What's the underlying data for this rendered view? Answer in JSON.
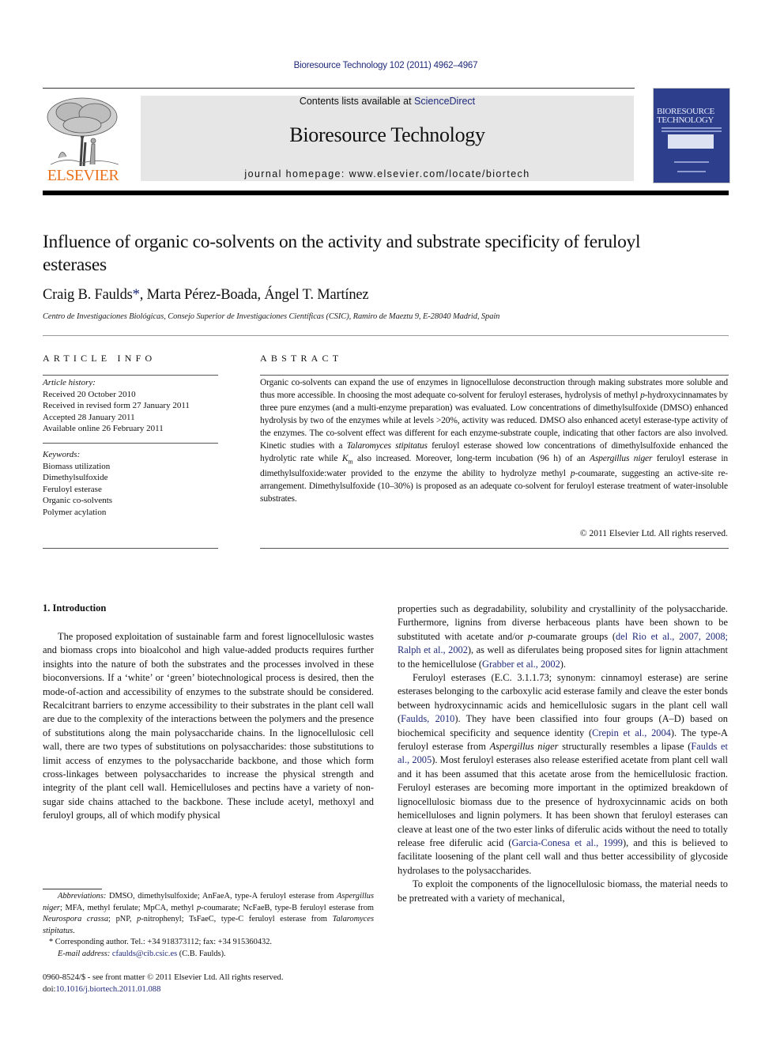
{
  "header": {
    "journal_ref": "Bioresource Technology 102 (2011) 4962–4967",
    "publisher_logo": "elsevier-tree-logo",
    "publisher_name": "ELSEVIER",
    "contents_prefix": "Contents lists available at ",
    "contents_link": "ScienceDirect",
    "journal_name": "Bioresource Technology",
    "homepage": "journal homepage: www.elsevier.com/locate/biortech",
    "cover_title_line1": "BIORESOURCE",
    "cover_title_line2": "TECHNOLOGY",
    "colors": {
      "elsevier_orange": "#e9711c",
      "link_blue": "#1f2a7a",
      "masthead_gray": "#e6e6e6",
      "cover_blue": "#2c3e8c"
    }
  },
  "article": {
    "title": "Influence of organic co-solvents on the activity and substrate specificity of feruloyl esterases",
    "authors": [
      {
        "name": "Craig B. Faulds",
        "mark": "*"
      },
      {
        "name": "Marta Pérez-Boada"
      },
      {
        "name": "Ángel T. Martínez"
      }
    ],
    "author_sep": ", ",
    "affiliation": "Centro de Investigaciones Biológicas, Consejo Superior de Investigaciones Científicas (CSIC), Ramiro de Maeztu 9, E-28040 Madrid, Spain"
  },
  "article_info": {
    "heading": "ARTICLE INFO",
    "history_label": "Article history:",
    "history": [
      "Received 20 October 2010",
      "Received in revised form 27 January 2011",
      "Accepted 28 January 2011",
      "Available online 26 February 2011"
    ],
    "keywords_label": "Keywords:",
    "keywords": [
      "Biomass utilization",
      "Dimethylsulfoxide",
      "Feruloyl esterase",
      "Organic co-solvents",
      "Polymer acylation"
    ]
  },
  "abstract": {
    "heading": "ABSTRACT",
    "parts": {
      "a": "Organic co-solvents can expand the use of enzymes in lignocellulose deconstruction through making substrates more soluble and thus more accessible. In choosing the most adequate co-solvent for feruloyl esterases, hydrolysis of methyl ",
      "p1": "p",
      "b": "-hydroxycinnamates by three pure enzymes (and a multi-enzyme preparation) was evaluated. Low concentrations of dimethylsulfoxide (DMSO) enhanced hydrolysis by two of the enzymes while at levels >20%, activity was reduced. DMSO also enhanced acetyl esterase-type activity of the enzymes. The co-solvent effect was different for each enzyme-substrate couple, indicating that other factors are also involved. Kinetic studies with a ",
      "sp1": "Talaromyces stipitatus",
      "c": " feruloyl esterase showed low concentrations of dimethylsulfoxide enhanced the hydrolytic rate while ",
      "km": "K",
      "km_sub": "m",
      "d": " also increased. Moreover, long-term incubation (96 h) of an ",
      "sp2": "Aspergillus niger",
      "e": " feruloyl esterase in dimethylsulfoxide:water provided to the enzyme the ability to hydrolyze methyl ",
      "p2": "p",
      "f": "-coumarate, suggesting an active-site re-arrangement. Dimethylsulfoxide (10–30%) is proposed as an adequate co-solvent for feruloyl esterase treatment of water-insoluble substrates."
    },
    "copyright": "© 2011 Elsevier Ltd. All rights reserved."
  },
  "introduction": {
    "heading": "1. Introduction",
    "para1": "The proposed exploitation of sustainable farm and forest lignocellulosic wastes and biomass crops into bioalcohol and high value-added products requires further insights into the nature of both the substrates and the processes involved in these bioconversions. If a ‘white’ or ‘green’ biotechnological process is desired, then the mode-of-action and accessibility of enzymes to the substrate should be considered. Recalcitrant barriers to enzyme accessibility to their substrates in the plant cell wall are due to the complexity of the interactions between the polymers and the presence of substitutions along the main polysaccharide chains. In the lignocellulosic cell wall, there are two types of substitutions on polysaccharides: those substitutions to limit access of enzymes to the polysaccharide backbone, and those which form cross-linkages between polysaccharides to increase the physical strength and integrity of the plant cell wall. Hemicelluloses and pectins have a variety of non-sugar side chains attached to the backbone. These include acetyl, methoxyl and feruloyl groups, all of which modify physical",
    "para1_cont": {
      "a": "properties such as degradability, solubility and crystallinity of the polysaccharide. Furthermore, lignins from diverse herbaceous plants have been shown to be substituted with acetate and/or ",
      "p": "p",
      "b": "-coumarate groups (",
      "cite1": "del Rio et al., 2007, 2008; Ralph et al., 2002",
      "c": "), as well as diferulates being proposed sites for lignin attachment to the hemicellulose (",
      "cite2": "Grabber et al., 2002",
      "d": ")."
    },
    "para2": {
      "a": "Feruloyl esterases (E.C. 3.1.1.73; synonym: cinnamoyl esterase) are serine esterases belonging to the carboxylic acid esterase family and cleave the ester bonds between hydroxycinnamic acids and hemicellulosic sugars in the plant cell wall (",
      "cite1": "Faulds, 2010",
      "b": "). They have been classified into four groups (A–D) based on biochemical specificity and sequence identity (",
      "cite2": "Crepin et al., 2004",
      "c": "). The type-A feruloyl esterase from ",
      "sp": "Aspergillus niger",
      "d": " structurally resembles a lipase (",
      "cite3": "Faulds et al., 2005",
      "e": "). Most feruloyl esterases also release esterified acetate from plant cell wall and it has been assumed that this acetate arose from the hemicellulosic fraction. Feruloyl esterases are becoming more important in the optimized breakdown of lignocellulosic biomass due to the presence of hydroxycinnamic acids on both hemicelluloses and lignin polymers. It has been shown that feruloyl esterases can cleave at least one of the two ester links of diferulic acids without the need to totally release free diferulic acid (",
      "cite4": "Garcia-Conesa et al., 1999",
      "f": "), and this is believed to facilitate loosening of the plant cell wall and thus better accessibility of glycoside hydrolases to the polysaccharides."
    },
    "para3": "To exploit the components of the lignocellulosic biomass, the material needs to be pretreated with a variety of mechanical,"
  },
  "footnotes": {
    "abbrev_label": "Abbreviations:",
    "abbrev": {
      "a": " DMSO, dimethylsulfoxide; AnFaeA, type-A feruloyl esterase from ",
      "sp1": "Aspergillus niger",
      "b": "; MFA, methyl ferulate; MpCA, methyl ",
      "p1": "p",
      "c": "-coumarate; NcFaeB, type-B feruloyl esterase from ",
      "sp2": "Neurospora crassa",
      "d": "; pNP, ",
      "p2": "p",
      "e": "-nitrophenyl; TsFaeC, type-C feruloyl esterase from ",
      "sp3": "Talaromyces stipitatus",
      "f": "."
    },
    "corresponding": "* Corresponding author. Tel.: +34 918373112; fax: +34 915360432.",
    "email_label": "E-mail address:",
    "email": "cfaulds@cib.csic.es",
    "email_suffix": " (C.B. Faulds).",
    "front_matter": "0960-8524/$ - see front matter © 2011 Elsevier Ltd. All rights reserved.",
    "doi_prefix": "doi:",
    "doi": "10.1016/j.biortech.2011.01.088"
  }
}
